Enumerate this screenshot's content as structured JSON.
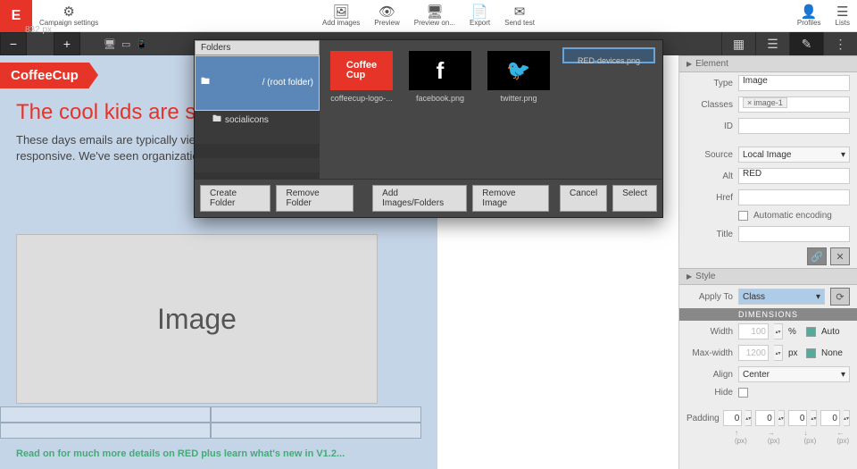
{
  "toolbar": {
    "campaign_settings": "Campaign settings",
    "add_images": "Add images",
    "preview": "Preview",
    "preview_on": "Preview on...",
    "export": "Export",
    "send_test": "Send test",
    "profiles": "Profiles",
    "lists": "Lists"
  },
  "subbar": {
    "width_px": "832 px"
  },
  "canvas": {
    "brand": "CoffeeCup",
    "headline": "The cool kids are sending mobile-friendly emails.",
    "body": "These days emails are typically viewed on a mobile device first. That means your emails, invoices or newsletters need to be responsive. We've seen organizations large and small use RED to create amazingly cool mailing masterpieces. It's...",
    "placeholder": "Image",
    "footnote": "Read on for much more details on RED plus learn what's new in V1.2..."
  },
  "modal": {
    "folders_label": "Folders",
    "root": "/ (root folder)",
    "sub": "socialicons",
    "thumbs": [
      {
        "label": "coffeecup-logo-..."
      },
      {
        "label": "facebook.png"
      },
      {
        "label": "twitter.png"
      },
      {
        "label": "RED-devices.png"
      }
    ],
    "create_folder": "Create Folder",
    "remove_folder": "Remove Folder",
    "add_images": "Add Images/Folders",
    "remove_image": "Remove Image",
    "cancel": "Cancel",
    "select": "Select"
  },
  "panel": {
    "element": "Element",
    "type_l": "Type",
    "type_v": "Image",
    "classes_l": "Classes",
    "class_tag": "image-1",
    "id_l": "ID",
    "source_l": "Source",
    "source_v": "Local Image",
    "alt_l": "Alt",
    "alt_v": "RED",
    "href_l": "Href",
    "auto_enc": "Automatic encoding",
    "title_l": "Title",
    "style": "Style",
    "apply_l": "Apply To",
    "apply_v": "Class",
    "dimensions": "DIMENSIONS",
    "width_l": "Width",
    "width_v": "100",
    "width_u": "%",
    "auto": "Auto",
    "maxw_l": "Max-width",
    "maxw_v": "1200",
    "maxw_u": "px",
    "none": "None",
    "align_l": "Align",
    "align_v": "Center",
    "hide_l": "Hide",
    "padding_l": "Padding",
    "pad": [
      "0",
      "0",
      "0",
      "0"
    ],
    "pad_lbl": [
      "↑ (px)",
      "→ (px)",
      "↓ (px)",
      "← (px)"
    ]
  }
}
